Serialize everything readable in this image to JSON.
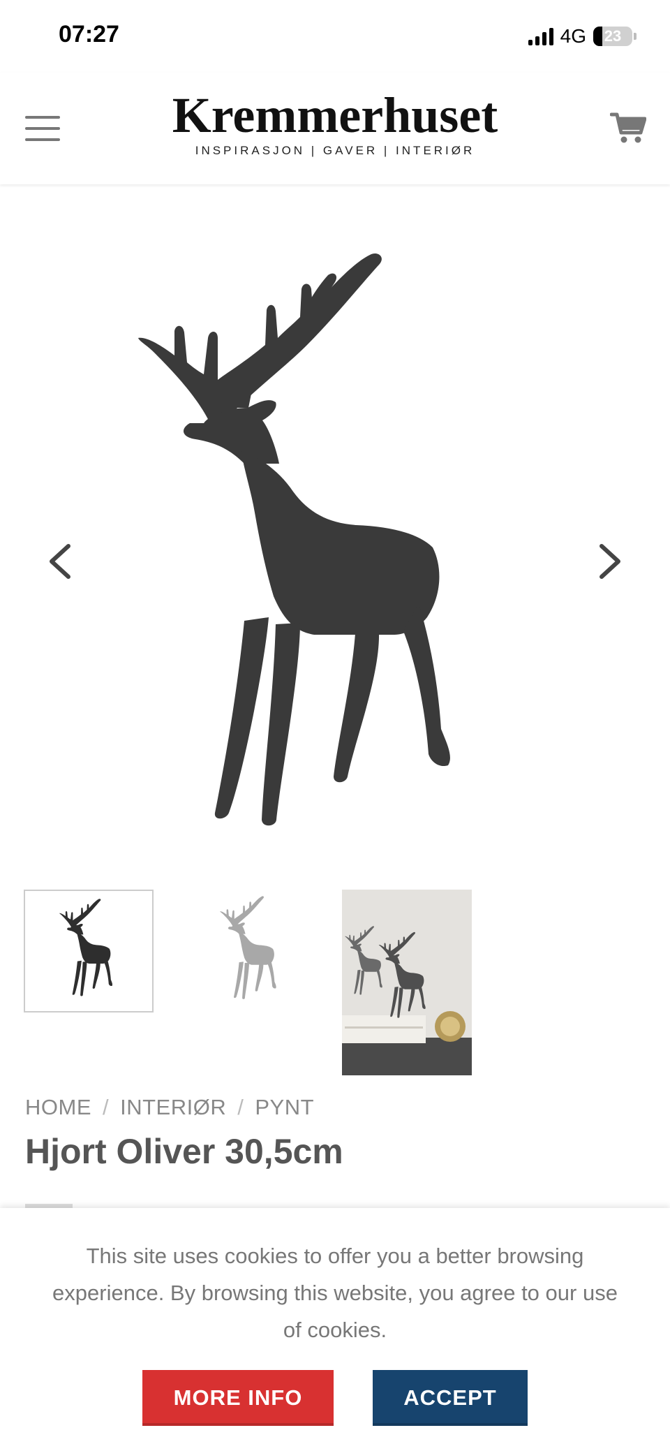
{
  "status_bar": {
    "time": "07:27",
    "network": "4G",
    "battery_level": "23",
    "icons": [
      "signal-icon",
      "battery-icon"
    ]
  },
  "header": {
    "logo_text": "Kremmerhuset",
    "tagline": "INSPIRASJON | GAVER | INTERIØR",
    "menu_icon": "hamburger-menu-icon",
    "cart_icon": "shopping-cart-icon"
  },
  "gallery": {
    "prev_icon": "chevron-left-icon",
    "next_icon": "chevron-right-icon",
    "thumbnails_count": 3,
    "active_thumbnail": 1
  },
  "breadcrumb": {
    "items": [
      "HOME",
      "INTERIØR",
      "PYNT"
    ],
    "separator": "/"
  },
  "product": {
    "title": "Hjort Oliver 30,5cm"
  },
  "cookie_banner": {
    "text": "This site uses cookies to offer you a better browsing experience. By browsing this website, you agree to our use of cookies.",
    "more_info_label": "MORE INFO",
    "accept_label": "ACCEPT",
    "colors": {
      "more_info": "#d83131",
      "accept": "#17446e"
    }
  }
}
